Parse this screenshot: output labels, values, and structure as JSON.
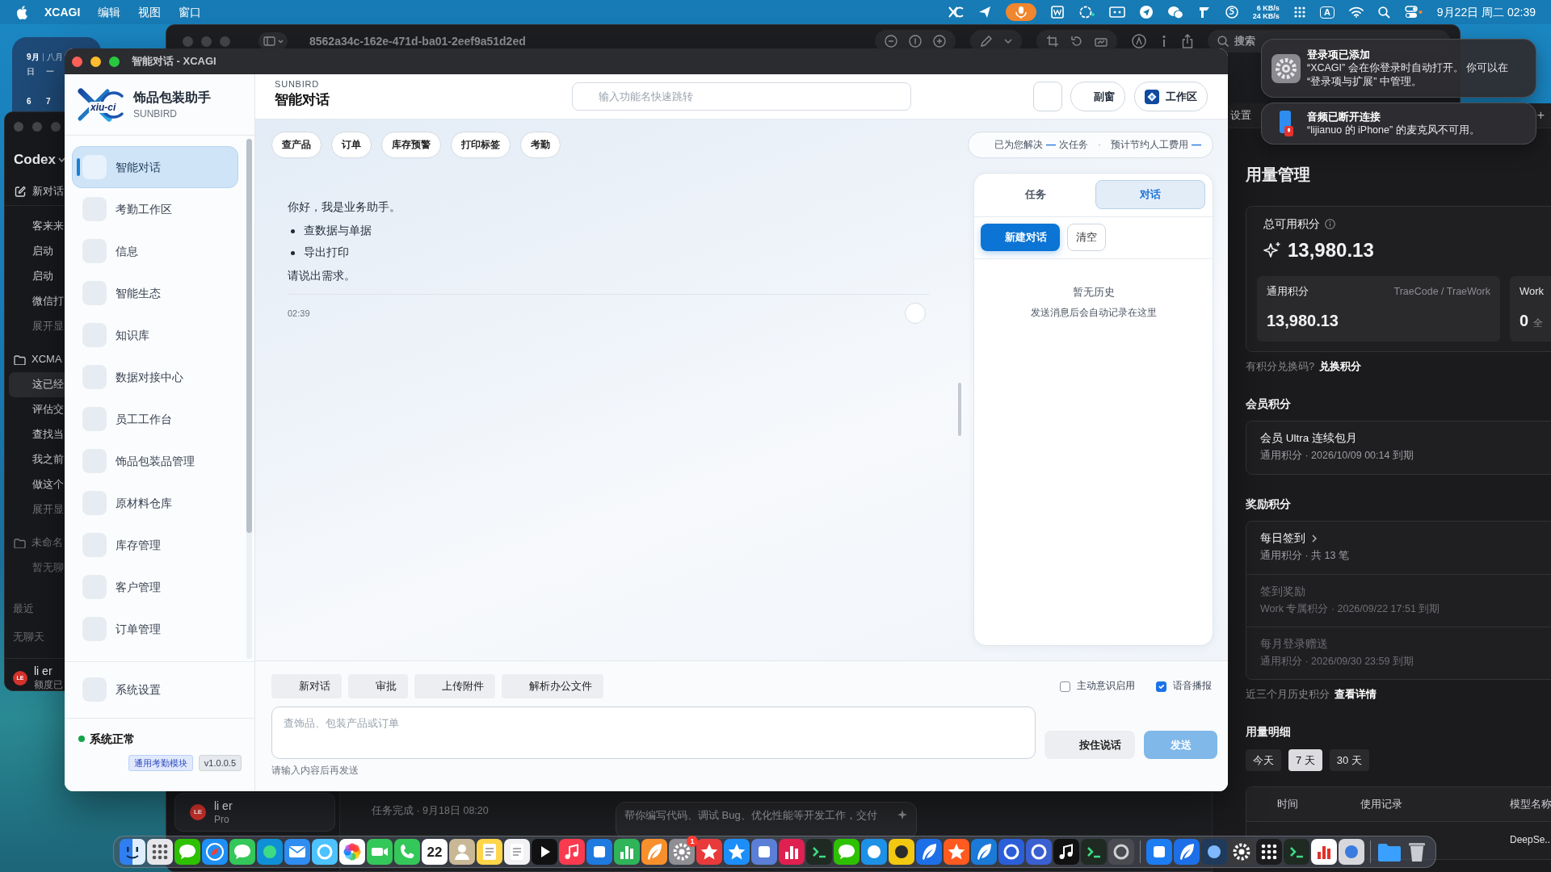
{
  "menu_bar": {
    "app": "XCAGI",
    "menus": [
      "编辑",
      "视图",
      "窗口"
    ],
    "recording": true,
    "net_up": "6 KB/s",
    "net_down": "24 KB/s",
    "input_source": "A",
    "clock": "9月22日 周二 02:39"
  },
  "calendar_widget": {
    "month": "9月",
    "lunar_month": "八月",
    "weekdays": [
      "日",
      "一"
    ],
    "days": [
      "6",
      "7"
    ]
  },
  "codex_window": {
    "title": "Codex",
    "new_chat": "新对话",
    "groups": [
      {
        "items": [
          {
            "label": "客来来",
            "kind": "chat",
            "selected": false
          },
          {
            "label": "启动",
            "kind": "chat",
            "selected": false
          },
          {
            "label": "启动",
            "kind": "chat",
            "selected": false
          },
          {
            "label": "微信打",
            "kind": "chat",
            "selected": false
          },
          {
            "label": "展开显",
            "kind": "more",
            "selected": false
          }
        ]
      },
      {
        "folder": "XCMA",
        "muted": false,
        "items": [
          {
            "label": "这已经",
            "kind": "chat",
            "selected": true
          },
          {
            "label": "评估交",
            "kind": "chat",
            "selected": false
          },
          {
            "label": "查找当",
            "kind": "chat",
            "selected": false
          },
          {
            "label": "我之前",
            "kind": "chat",
            "selected": false
          },
          {
            "label": "做这个",
            "kind": "chat",
            "selected": false
          },
          {
            "label": "展开显",
            "kind": "more",
            "selected": false
          }
        ]
      },
      {
        "folder": "未命名",
        "muted": true,
        "empty": "暂无聊"
      }
    ],
    "recent": {
      "title": "最近",
      "empty": "无聊天"
    },
    "user": {
      "initials": "LE",
      "name": "li er",
      "plan": "额度已"
    }
  },
  "back_window": {
    "title": "8562a34c-162e-471d-ba01-2eef9a51d2ed",
    "search": "搜索",
    "user": {
      "initials": "LE",
      "name": "li er",
      "plan": "Pro"
    },
    "task_status": "任务完成 · 9月18日 08:20",
    "prompt_placeholder": "帮你编写代码、调试 Bug、优化性能等开发工作，交付"
  },
  "usage_window": {
    "tab": "设置",
    "new_tab": "+",
    "title": "用量管理",
    "total": {
      "label": "总可用积分",
      "value": "13,980.13"
    },
    "balances": [
      {
        "label": "通用积分",
        "scope": "TraeCode / TraeWork",
        "value": "13,980.13"
      },
      {
        "label": "Work",
        "value": "0",
        "note": "全"
      }
    ],
    "redeem": {
      "prompt": "有积分兑换码?",
      "link": "兑换积分"
    },
    "sections": [
      {
        "title": "会员积分",
        "items": [
          {
            "name": "会员 Ultra 连续包月",
            "detail": "通用积分 · 2026/10/09 00:14 到期",
            "active": true,
            "expandable": false
          }
        ]
      },
      {
        "title": "奖励积分",
        "items": [
          {
            "name": "每日签到",
            "detail": "通用积分 · 共 13 笔",
            "active": true,
            "expandable": true
          },
          {
            "name": "签到奖励",
            "detail": "Work 专属积分 · 2026/09/22 17:51 到期",
            "active": false,
            "expandable": false
          },
          {
            "name": "每月登录赠送",
            "detail": "通用积分 · 2026/09/30 23:59 到期",
            "active": false,
            "expandable": false
          }
        ]
      }
    ],
    "history": {
      "prompt": "近三个月历史积分",
      "link": "查看详情"
    },
    "details": {
      "title": "用量明细",
      "ranges": [
        {
          "label": "今天",
          "selected": false
        },
        {
          "label": "7 天",
          "selected": true
        },
        {
          "label": "30 天",
          "selected": false
        }
      ],
      "columns": [
        "时间",
        "使用记录",
        "模型名称"
      ],
      "rows": [
        {
          "model": "DeepSe..."
        }
      ]
    }
  },
  "app_window": {
    "title": "智能对话 - XCAGI",
    "brand": {
      "logo_text": "xiu-ci",
      "name": "饰品包装助手",
      "sub": "SUNBIRD"
    },
    "nav": [
      {
        "label": "智能对话",
        "selected": true
      },
      {
        "label": "考勤工作区",
        "selected": false
      },
      {
        "label": "信息",
        "selected": false
      },
      {
        "label": "智能生态",
        "selected": false
      },
      {
        "label": "知识库",
        "selected": false
      },
      {
        "label": "数据对接中心",
        "selected": false
      },
      {
        "label": "员工工作台",
        "selected": false
      },
      {
        "label": "饰品包装品管理",
        "selected": false
      },
      {
        "label": "原材料仓库",
        "selected": false
      },
      {
        "label": "库存管理",
        "selected": false
      },
      {
        "label": "客户管理",
        "selected": false
      },
      {
        "label": "订单管理",
        "selected": false
      }
    ],
    "settings_item": {
      "label": "系统设置",
      "selected": false
    },
    "status": {
      "text": "系统正常",
      "ok": true
    },
    "badges": [
      {
        "label": "通用考勤模块",
        "kind": "module"
      },
      {
        "label": "v1.0.0.5",
        "kind": "version"
      }
    ],
    "header": {
      "eyebrow": "SUNBIRD",
      "title": "智能对话",
      "search_placeholder": "输入功能名快速跳转",
      "buttons": [
        {
          "kind": "blank"
        },
        {
          "kind": "plain",
          "label": "副窗"
        },
        {
          "kind": "workspace",
          "label": "工作区"
        }
      ]
    },
    "quick_actions": [
      "查产品",
      "订单",
      "库存预警",
      "打印标签",
      "考勤"
    ],
    "stats": {
      "solved_label": "已为您解决",
      "solved_value": "—",
      "solved_unit": "次任务",
      "separator": "·",
      "saved_label": "预计节约人工费用",
      "saved_value": "—"
    },
    "messages": [
      {
        "kind": "text",
        "text": "你好，我是业务助手。"
      },
      {
        "kind": "list",
        "items": [
          "查数据与单据",
          "导出打印"
        ]
      },
      {
        "kind": "text",
        "text": "请说出需求。"
      }
    ],
    "message_time": "02:39",
    "side_panel": {
      "tabs": [
        {
          "label": "任务",
          "selected": false
        },
        {
          "label": "对话",
          "selected": true
        }
      ],
      "actions": [
        {
          "label": "新建对话",
          "kind": "primary"
        },
        {
          "label": "清空",
          "kind": "outline"
        }
      ],
      "empty_title": "暂无历史",
      "empty_hint": "发送消息后会自动记录在这里"
    },
    "composer": {
      "actions": [
        "新对话",
        "审批",
        "上传附件",
        "解析办公文件"
      ],
      "toggles": [
        {
          "label": "主动意识启用",
          "checked": false
        },
        {
          "label": "语音播报",
          "checked": true
        }
      ],
      "placeholder": "查饰品、包装产品或订单",
      "talk": "按住说话",
      "send": {
        "label": "发送",
        "disabled": true
      },
      "hint": "请输入内容后再发送"
    }
  },
  "notifications": [
    {
      "kind": "settings",
      "title": "登录项已添加",
      "body": "“XCAGI” 会在你登录时自动打开。 你可以在\n“登录项与扩展” 中管理。"
    },
    {
      "kind": "audio",
      "title": "音频已断开连接",
      "body": "“lijianuo 的 iPhone” 的麦克风不可用。"
    }
  ],
  "dock": {
    "calendar_day": "22",
    "badge": "1"
  }
}
